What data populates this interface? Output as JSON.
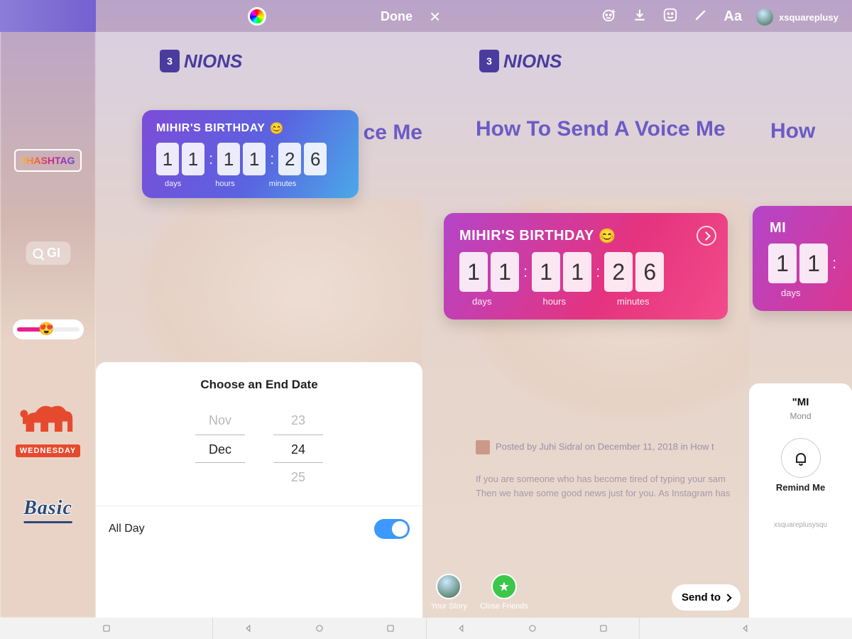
{
  "panel1": {
    "hashtag": "#HASHTAG",
    "gif": "GI",
    "dayLabel": "WEDNESDAY",
    "basic": "Basic"
  },
  "panel2": {
    "done": "Done",
    "logo": "NIONS",
    "headlinePartial": "ce Me",
    "countdown": {
      "title": "MIHIR'S BIRTHDAY",
      "emoji": "😊",
      "d1": "1",
      "d2": "1",
      "h1": "1",
      "h2": "1",
      "m1": "2",
      "m2": "6",
      "daysLabel": "days",
      "hoursLabel": "hours",
      "minutesLabel": "minutes"
    },
    "sheet": {
      "title": "Choose an End Date",
      "monthPrev": "Nov",
      "monthSel": "Dec",
      "dayPrev": "23",
      "daySel": "24",
      "dayNext": "25",
      "allDay": "All Day"
    }
  },
  "panel3": {
    "aa": "Aa",
    "logo": "NIONS",
    "headline": "How To Send A Voice Me",
    "countdown": {
      "title": "MIHIR'S BIRTHDAY",
      "emoji": "😊",
      "d1": "1",
      "d2": "1",
      "h1": "1",
      "h2": "1",
      "m1": "2",
      "m2": "6",
      "daysLabel": "days",
      "hoursLabel": "hours",
      "minutesLabel": "minutes"
    },
    "postedBy": "Posted by Juhi Sidral on December 11, 2018 in How t",
    "body1": "If you are someone who has become tired of typing your sam",
    "body2": "Then we have some good news just for you. As Instagram has",
    "yourStory": "Your Story",
    "closeFriends": "Close Friends",
    "sendTo": "Send to"
  },
  "panel4": {
    "username": "xsquareplusy",
    "headline": "How",
    "countdown": {
      "title": "MI",
      "d1": "1",
      "d2": "1",
      "daysLabel": "days"
    },
    "sheetTitle": "\"MI",
    "sheetSub": "Mond",
    "remind": "Remind Me",
    "credit": "xsquareplusysqu"
  }
}
